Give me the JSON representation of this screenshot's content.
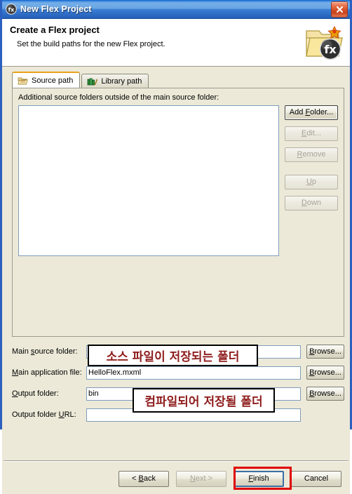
{
  "window": {
    "title": "New Flex Project",
    "title_icon": "flex-fx-icon",
    "close_label": "✕"
  },
  "header": {
    "title": "Create a Flex project",
    "subtitle": "Set the build paths for the new Flex project.",
    "icon": "flex-project-folder-icon"
  },
  "tabs": [
    {
      "label": "Source path",
      "icon": "source-folder-icon",
      "active": true
    },
    {
      "label": "Library path",
      "icon": "library-books-icon",
      "active": false
    }
  ],
  "source_path_panel": {
    "list_label": "Additional source folders outside of the main source folder:",
    "list_items": [],
    "buttons": [
      {
        "label": "Add Folder...",
        "mnemonic": "F",
        "enabled": true,
        "focused": true
      },
      {
        "label": "Edit...",
        "mnemonic": "E",
        "enabled": false,
        "focused": false
      },
      {
        "label": "Remove",
        "mnemonic": "R",
        "enabled": false,
        "focused": false
      },
      {
        "label": "Up",
        "mnemonic": "U",
        "enabled": false,
        "focused": false
      },
      {
        "label": "Down",
        "mnemonic": "D",
        "enabled": false,
        "focused": false
      }
    ]
  },
  "form": {
    "browse_label": "Browse...",
    "browse_mnemonic": "B",
    "fields": [
      {
        "label_pre": "Main ",
        "label_mn": "s",
        "label_post": "ource folder:",
        "value": "",
        "placeholder": "",
        "browse": true
      },
      {
        "label_pre": "",
        "label_mn": "M",
        "label_post": "ain application file:",
        "value": "HelloFlex.mxml",
        "placeholder": "",
        "browse": true
      },
      {
        "label_pre": "",
        "label_mn": "O",
        "label_post": "utput folder:",
        "value": "bin",
        "placeholder": "",
        "browse": true
      },
      {
        "label_pre": "Output folder ",
        "label_mn": "U",
        "label_post": "RL:",
        "value": "",
        "placeholder": "",
        "browse": false
      }
    ]
  },
  "annotations": [
    {
      "text": "소스 파일이 저장되는 폴더",
      "color": "#8f1d1d"
    },
    {
      "text": "컴파일되어 저장될 폴더",
      "color": "#8f1d1d"
    }
  ],
  "highlight": {
    "target": "Finish",
    "color": "#e00000"
  },
  "footer": {
    "buttons": [
      {
        "label": "< Back",
        "mnemonic": "B",
        "enabled": true,
        "default": false
      },
      {
        "label": "Next >",
        "mnemonic": "N",
        "enabled": false,
        "default": false
      },
      {
        "label": "Finish",
        "mnemonic": "F",
        "enabled": true,
        "default": true
      },
      {
        "label": "Cancel",
        "mnemonic": "",
        "enabled": true,
        "default": false
      }
    ]
  },
  "colors": {
    "title_bar_top": "#74aee8",
    "title_bar_bottom": "#2a66bf",
    "dialog_bg": "#ece9d8",
    "active_tab_accent": "#e8a11c",
    "annotation_red": "#8f1d1d",
    "highlight_red": "#e00000"
  }
}
